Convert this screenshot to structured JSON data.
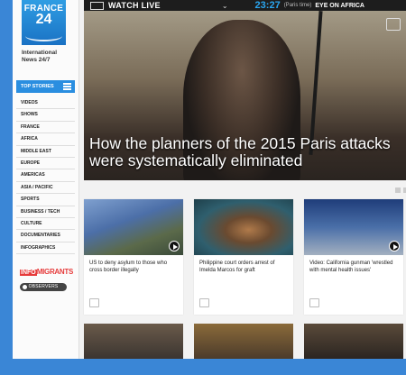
{
  "topbar": {
    "watch_label": "WATCH LIVE",
    "time": "23:27",
    "time_note": "(Paris time)",
    "program": "EYE ON AFRICA"
  },
  "logo": {
    "line1": "FRANCE",
    "line2": "24",
    "tagline_1": "International",
    "tagline_2": "News 24/7"
  },
  "nav": {
    "top_stories": "TOP STORIES",
    "items": [
      "VIDEOS",
      "SHOWS",
      "FRANCE",
      "AFRICA",
      "MIDDLE EAST",
      "EUROPE",
      "AMERICAS",
      "ASIA / PACIFIC",
      "SPORTS",
      "BUSINESS / TECH",
      "CULTURE",
      "DOCUMENTARIES",
      "INFOGRAPHICS"
    ],
    "info_migrants_a": "INFO",
    "info_migrants_b": "MIGRANTS",
    "observers": "OBSERVERS"
  },
  "hero": {
    "headline": "How the planners of the 2015 Paris attacks were systematically eliminated"
  },
  "cards": [
    {
      "caption": "US to deny asylum to those who cross border illegally",
      "colors": [
        "#4c6fa8",
        "#3a4a3a"
      ]
    },
    {
      "caption": "Philippine court orders arrest of Imelda Marcos for graft",
      "colors": [
        "#2f5f6e",
        "#6a4a30"
      ]
    },
    {
      "caption": "Video: California gunman 'wrestled with mental health issues'",
      "colors": [
        "#1f3d7a",
        "#a3b0c0"
      ]
    }
  ],
  "colors": {
    "accent": "#2a8ee0",
    "brand_red": "#e63b3b",
    "bar": "#1d1d1d"
  }
}
